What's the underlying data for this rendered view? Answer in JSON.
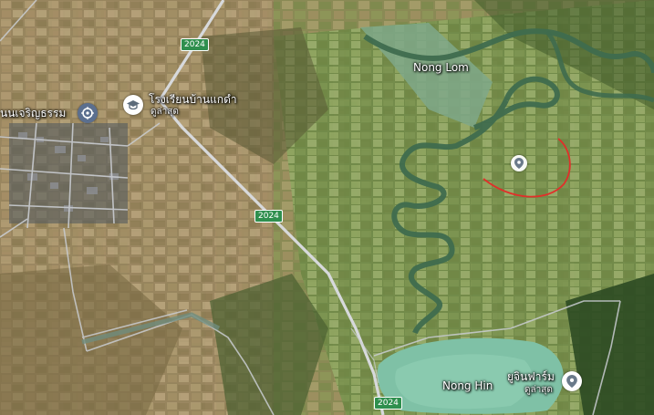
{
  "map": {
    "road_number": "2024",
    "places": [
      {
        "name": "Nong Lom"
      },
      {
        "name": "Nong Hin"
      }
    ],
    "pois": [
      {
        "name": "นนเจริญธรรม",
        "icon": "temple-icon"
      },
      {
        "name": "โรงเรียนบ้านแกดำ",
        "sub": "ดูล่าสุด",
        "icon": "school-icon"
      },
      {
        "name": "ยูจินฟาร์ม",
        "sub": "ดูล่าสุด",
        "icon": "location-pin-icon"
      }
    ],
    "pin": {
      "icon": "location-pin-icon"
    },
    "colors": {
      "road_shield": "#2f8f4e",
      "boundary": "#e0302a",
      "water": "#7fc1a6"
    }
  }
}
